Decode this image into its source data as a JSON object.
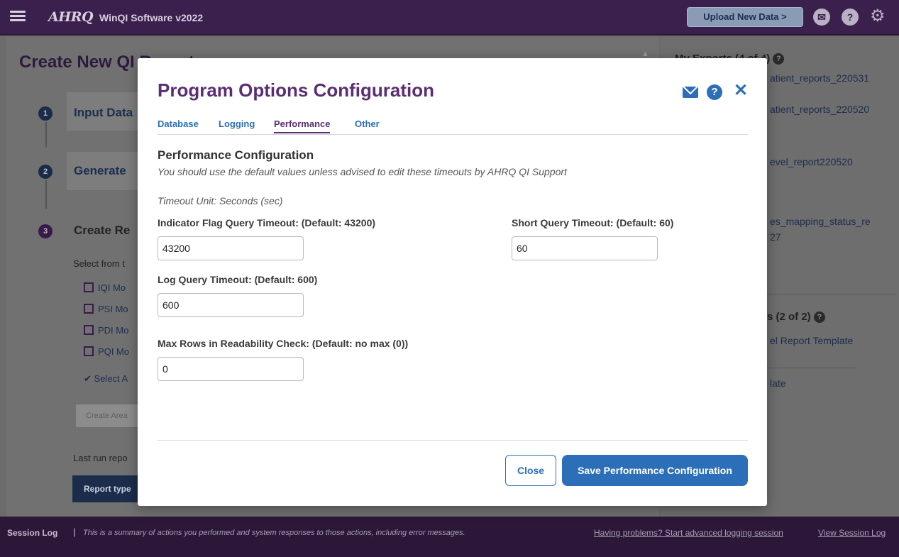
{
  "topbar": {
    "logo": "AHRQ",
    "title": "WinQI Software v2022",
    "upload_label": "Upload New Data  >",
    "icons": [
      "menu-icon",
      "mail-icon",
      "help-icon",
      "gear-icon"
    ]
  },
  "background": {
    "page_title": "Create New QI Report",
    "steps": [
      {
        "number": "1",
        "label": "Input Data"
      },
      {
        "number": "2",
        "label": "Generate"
      },
      {
        "number": "3",
        "label": "Create Re"
      }
    ],
    "select_text": "Select from t",
    "checkboxes": [
      "IQI Mo",
      "PSI Mo",
      "PDI Mo",
      "PQI Mo"
    ],
    "select_all": "Select A",
    "create_area_label": "Create Area",
    "last_run_text": "Last run repo",
    "report_type_label": "Report type"
  },
  "right_panel": {
    "my_exports_title": "My Exports (4 of 4)",
    "export_links": [
      "atient_reports_220531",
      "atient_reports_220520",
      "evel_report220520",
      "es_mapping_status_re",
      "27"
    ],
    "templates_title": "s (2 of 2)",
    "template_links": [
      "el Report Template",
      "late"
    ]
  },
  "modal": {
    "title": "Program Options Configuration",
    "tabs": [
      "Database",
      "Logging",
      "Performance",
      "Other"
    ],
    "active_tab": "Performance",
    "section_title": "Performance Configuration",
    "section_subtitle": "You should use the default values unless advised to edit these timeouts by AHRQ QI Support",
    "timeout_unit": "Timeout Unit: Seconds (sec)",
    "fields": {
      "indicator_flag": {
        "label": "Indicator Flag Query Timeout: (Default: 43200)",
        "value": "43200"
      },
      "short_query": {
        "label": "Short Query Timeout: (Default: 60)",
        "value": "60"
      },
      "log_query": {
        "label": "Log Query Timeout: (Default: 600)",
        "value": "600"
      },
      "max_rows": {
        "label": "Max Rows in Readability Check: (Default: no max (0))",
        "value": "0"
      }
    },
    "close_label": "Close",
    "save_label": "Save Performance Configuration"
  },
  "footer": {
    "label": "Session Log",
    "separator": "|",
    "message": "This is a summary of actions you performed and system responses to those actions, including error messages.",
    "advanced_link": "Having problems? Start advanced logging session",
    "view_link": "View Session Log"
  },
  "colors": {
    "brand_purple": "#5b2d74",
    "link_blue": "#2c6fb8",
    "header_dark": "#3b1f4d"
  }
}
